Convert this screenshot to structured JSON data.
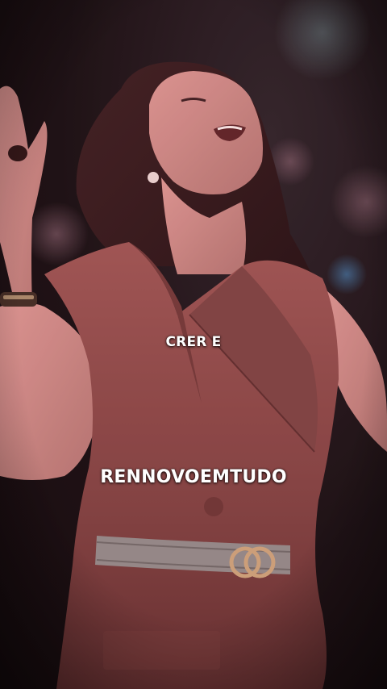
{
  "overlay": {
    "line1": "CRER E",
    "line2": "RENNOVOEMTUDO"
  },
  "colors": {
    "background": "#0d0a0c",
    "dress": "#8a4a48",
    "skin": "#c98a86",
    "caption_text": "#ffffff"
  }
}
